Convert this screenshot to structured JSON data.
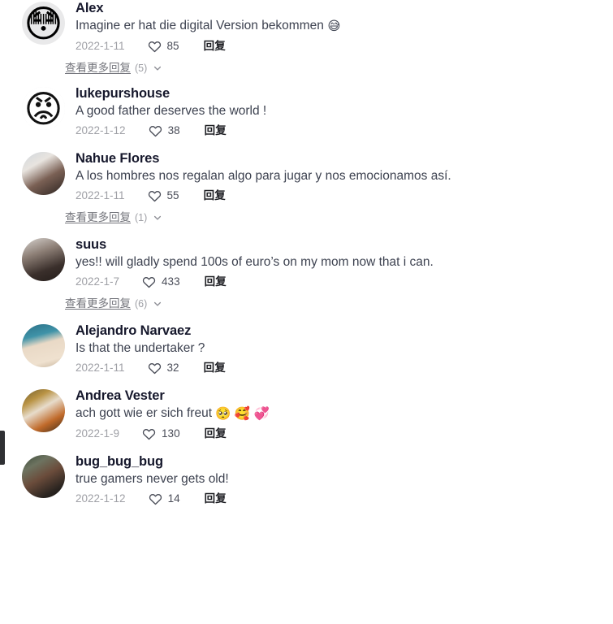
{
  "app": {
    "view": "comment-list",
    "reply_label": "回复",
    "more_replies_label": "查看更多回复",
    "colors": {
      "background": "#ffffff",
      "username": "#16182c",
      "comment_text": "#3d4250",
      "date": "#9fa0a6",
      "reply_link": "#1c1d22",
      "more_replies": "#73747b",
      "scrollbar_thumb": "#2f3033"
    }
  },
  "scrollbar": {
    "name": "vertical-scrollbar-thumb",
    "position": "left-edge"
  },
  "comments": [
    {
      "username": "Alex",
      "text": "Imagine er hat die digital Version bekommen ",
      "emojis": "😅",
      "date": "2022-1-11",
      "likes": "85",
      "reply_label": "回复",
      "avatar_kind": "emoji",
      "avatar_glyph": "😳",
      "more_replies": {
        "label": "查看更多回复",
        "count": "(5)"
      }
    },
    {
      "username": "lukepurshouse",
      "text": "A good father deserves the world !",
      "emojis": "",
      "date": "2022-1-12",
      "likes": "38",
      "reply_label": "回复",
      "avatar_kind": "meme",
      "avatar_glyph": "😡",
      "more_replies": null
    },
    {
      "username": "Nahue Flores",
      "text": "A los hombres nos regalan algo para jugar y nos emocionamos así.",
      "emojis": "",
      "date": "2022-1-11",
      "likes": "55",
      "reply_label": "回复",
      "avatar_kind": "photo",
      "avatar_glyph": "",
      "more_replies": {
        "label": "查看更多回复",
        "count": "(1)"
      }
    },
    {
      "username": "suus",
      "text": "yes!! will gladly spend 100s of euro’s on my mom now that i can.",
      "emojis": "",
      "date": "2022-1-7",
      "likes": "433",
      "reply_label": "回复",
      "avatar_kind": "photo",
      "avatar_glyph": "",
      "more_replies": {
        "label": "查看更多回复",
        "count": "(6)"
      }
    },
    {
      "username": "Alejandro Narvaez",
      "text": "Is that the undertaker ?",
      "emojis": "",
      "date": "2022-1-11",
      "likes": "32",
      "reply_label": "回复",
      "avatar_kind": "photo",
      "avatar_glyph": "",
      "more_replies": null
    },
    {
      "username": "Andrea Vester",
      "text": "ach gott wie er sich freut ",
      "emojis": "🥺 🥰 💞",
      "date": "2022-1-9",
      "likes": "130",
      "reply_label": "回复",
      "avatar_kind": "photo",
      "avatar_glyph": "",
      "more_replies": null
    },
    {
      "username": "bug_bug_bug",
      "text": "true gamers never gets old!",
      "emojis": "",
      "date": "2022-1-12",
      "likes": "14",
      "reply_label": "回复",
      "avatar_kind": "photo",
      "avatar_glyph": "",
      "more_replies": null
    }
  ]
}
